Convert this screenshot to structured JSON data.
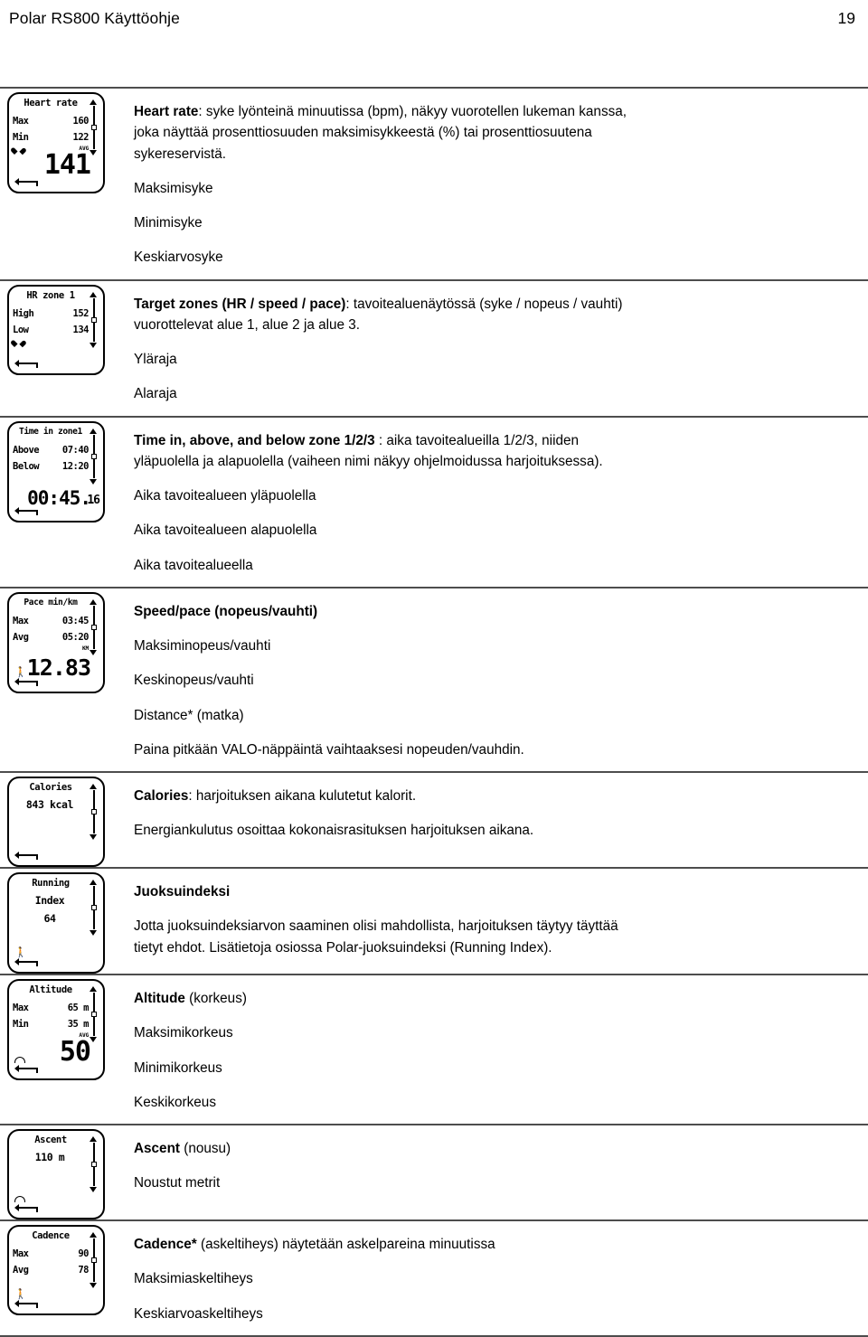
{
  "header": {
    "title": "Polar RS800 Käyttöohje",
    "page_number": "19"
  },
  "sections": [
    {
      "id": "heart-rate",
      "lcd": {
        "title": "Heart rate",
        "row1_label": "Max",
        "row1_value": "160",
        "row2_label": "Min",
        "row2_value": "122",
        "big_value": "141",
        "sup": "AVG",
        "icons": "heart, back-arrow, scrollbar"
      },
      "paragraphs": [
        {
          "bold": "Heart rate",
          "rest": ": syke lyönteinä minuutissa (bpm), näkyy vuorotellen lukeman kanssa, joka näyttää prosenttiosuuden maksimisykkeestä (%) tai prosenttiosuutena sykereservistä."
        },
        {
          "bold": "",
          "rest": "Maksimisyke"
        },
        {
          "bold": "",
          "rest": "Minimisyke"
        },
        {
          "bold": "",
          "rest": "Keskiarvosyke"
        }
      ]
    },
    {
      "id": "target-zones",
      "lcd": {
        "title": "HR zone 1",
        "row1_label": "High",
        "row1_value": "152",
        "row2_label": "Low",
        "row2_value": "134",
        "big_value": "",
        "sup": "",
        "icons": "heart, back-arrow, scrollbar"
      },
      "paragraphs": [
        {
          "bold": "Target zones (HR / speed / pace)",
          "rest": ": tavoitealuenäytössä (syke / nopeus / vauhti) vuorottelevat alue 1, alue 2 ja alue 3."
        },
        {
          "bold": "",
          "rest": "Yläraja"
        },
        {
          "bold": "",
          "rest": "Alaraja"
        }
      ]
    },
    {
      "id": "time-in-zone",
      "lcd": {
        "title": "Time in zone1",
        "row1_label": "Above",
        "row1_value": "07:40",
        "row2_label": "Below",
        "row2_value": "12:20",
        "big_value": "00:45.",
        "sup_value": "16",
        "icons": "back-arrow, scrollbar"
      },
      "paragraphs": [
        {
          "bold": "Time in, above, and below zone 1/2/3",
          "rest": " : aika tavoitealueilla 1/2/3, niiden yläpuolella ja alapuolella (vaiheen nimi näkyy ohjelmoidussa harjoituksessa)."
        },
        {
          "bold": "",
          "rest": "Aika tavoitealueen yläpuolella"
        },
        {
          "bold": "",
          "rest": "Aika tavoitealueen alapuolella"
        },
        {
          "bold": "",
          "rest": "Aika tavoitealueella"
        }
      ]
    },
    {
      "id": "speed-pace",
      "lcd": {
        "title": "Pace min/km",
        "row1_label": "Max",
        "row1_value": "03:45",
        "row2_label": "Avg",
        "row2_value": "05:20",
        "big_value": "12.83",
        "sup": "KM",
        "icons": "runner, back-arrow, scrollbar"
      },
      "paragraphs": [
        {
          "bold": "Speed/pace (nopeus/vauhti)",
          "rest": ""
        },
        {
          "bold": "",
          "rest": "Maksiminopeus/vauhti"
        },
        {
          "bold": "",
          "rest": "Keskinopeus/vauhti"
        },
        {
          "bold": "",
          "rest": "Distance* (matka)"
        },
        {
          "bold": "",
          "rest": "Paina pitkään VALO-näppäintä vaihtaaksesi nopeuden/vauhdin."
        }
      ]
    },
    {
      "id": "calories",
      "lcd": {
        "title": "Calories",
        "center_value": "843 kcal",
        "icons": "back-arrow, scrollbar"
      },
      "paragraphs": [
        {
          "bold": "Calories",
          "rest": ": harjoituksen aikana kulutetut kalorit."
        },
        {
          "bold": "",
          "rest": "Energiankulutus osoittaa kokonaisrasituksen harjoituksen aikana."
        }
      ]
    },
    {
      "id": "running-index",
      "lcd": {
        "title": "Running",
        "center_value": "Index",
        "center_value2": "64",
        "icons": "runner, back-arrow, scrollbar"
      },
      "paragraphs": [
        {
          "bold": "Juoksuindeksi",
          "rest": ""
        },
        {
          "bold": "",
          "rest": "Jotta juoksuindeksiarvon saaminen olisi mahdollista, harjoituksen täytyy täyttää tietyt ehdot. Lisätietoja osiossa Polar-juoksuindeksi (Running Index)."
        }
      ]
    },
    {
      "id": "altitude",
      "lcd": {
        "title": "Altitude",
        "row1_label": "Max",
        "row1_value": "65 m",
        "row2_label": "Min",
        "row2_value": "35 m",
        "big_value": "50",
        "sup": "AVG",
        "icons": "arc, back-arrow, scrollbar"
      },
      "paragraphs": [
        {
          "bold": "Altitude",
          "rest": " (korkeus)"
        },
        {
          "bold": "",
          "rest": "Maksimikorkeus"
        },
        {
          "bold": "",
          "rest": "Minimikorkeus"
        },
        {
          "bold": "",
          "rest": "Keskikorkeus"
        }
      ]
    },
    {
      "id": "ascent",
      "lcd": {
        "title": "Ascent",
        "center_value": "110 m",
        "icons": "arc, back-arrow, scrollbar"
      },
      "paragraphs": [
        {
          "bold": "Ascent",
          "rest": " (nousu)"
        },
        {
          "bold": "",
          "rest": "Noustut metrit"
        }
      ]
    },
    {
      "id": "cadence",
      "lcd": {
        "title": "Cadence",
        "row1_label": "Max",
        "row1_value": "90",
        "row2_label": "Avg",
        "row2_value": "78",
        "big_value": "",
        "icons": "runner, back-arrow, scrollbar"
      },
      "paragraphs": [
        {
          "bold": "Cadence*",
          "rest": " (askeltiheys) näytetään askelpareina minuutissa"
        },
        {
          "bold": "",
          "rest": "Maksimiaskeltiheys"
        },
        {
          "bold": "",
          "rest": "Keskiarvoaskeltiheys"
        }
      ]
    }
  ]
}
